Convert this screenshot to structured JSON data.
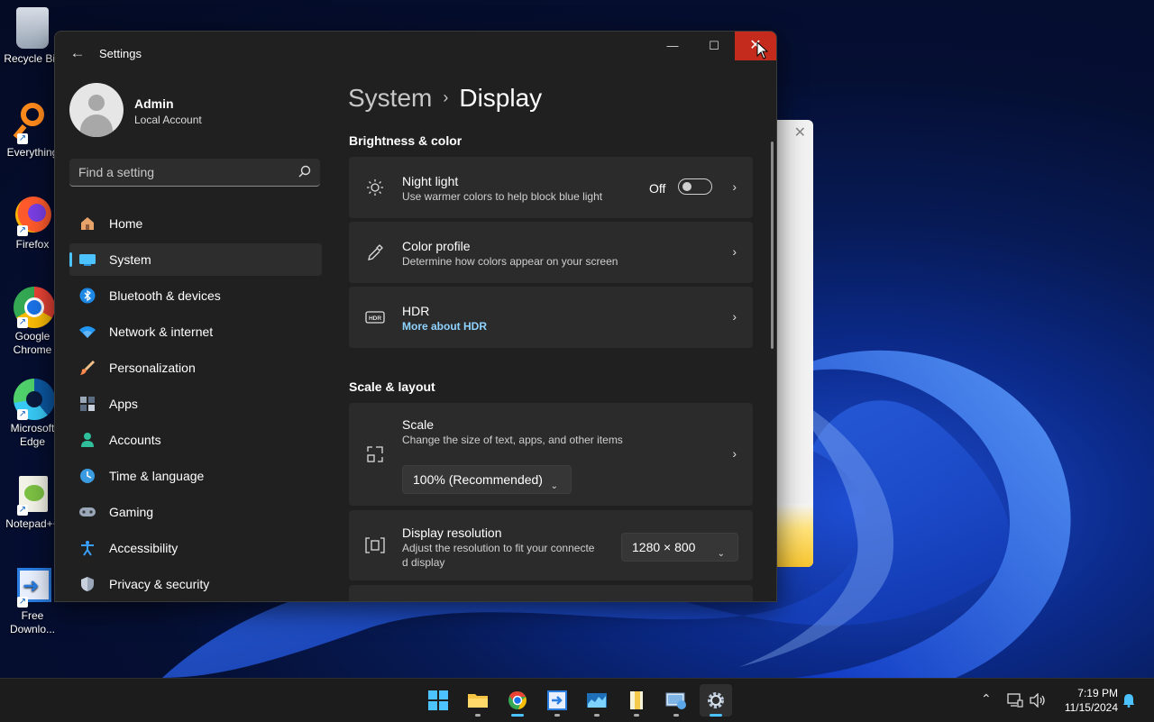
{
  "desktop": {
    "icons": [
      {
        "label": "Recycle Bin",
        "icon": "recycle-bin-icon"
      },
      {
        "label": "Everything",
        "icon": "everything-search-icon"
      },
      {
        "label": "Firefox",
        "icon": "firefox-icon"
      },
      {
        "label": "Google Chrome",
        "icon": "chrome-icon"
      },
      {
        "label": "Microsoft Edge",
        "icon": "edge-icon"
      },
      {
        "label": "Notepad++",
        "icon": "notepad-plus-plus-icon"
      },
      {
        "label": "Free Downlo...",
        "icon": "free-download-manager-icon"
      }
    ]
  },
  "window": {
    "title": "Settings",
    "controls": {
      "minimize": "—",
      "maximize": "☐",
      "close": "✕"
    }
  },
  "profile": {
    "name": "Admin",
    "account_type": "Local Account"
  },
  "search": {
    "placeholder": "Find a setting"
  },
  "nav": {
    "items": [
      {
        "label": "Home",
        "icon": "home-icon"
      },
      {
        "label": "System",
        "icon": "system-display-icon",
        "active": true
      },
      {
        "label": "Bluetooth & devices",
        "icon": "bluetooth-icon"
      },
      {
        "label": "Network & internet",
        "icon": "wifi-icon"
      },
      {
        "label": "Personalization",
        "icon": "paintbrush-icon"
      },
      {
        "label": "Apps",
        "icon": "apps-icon"
      },
      {
        "label": "Accounts",
        "icon": "accounts-icon"
      },
      {
        "label": "Time & language",
        "icon": "time-language-icon"
      },
      {
        "label": "Gaming",
        "icon": "gamepad-icon"
      },
      {
        "label": "Accessibility",
        "icon": "accessibility-icon"
      },
      {
        "label": "Privacy & security",
        "icon": "shield-icon"
      }
    ]
  },
  "breadcrumb": {
    "parent": "System",
    "separator": "›",
    "current": "Display"
  },
  "sections": {
    "brightness": {
      "heading": "Brightness & color",
      "night_light": {
        "title": "Night light",
        "subtitle": "Use warmer colors to help block blue light",
        "state_label": "Off",
        "enabled": false
      },
      "color_profile": {
        "title": "Color profile",
        "subtitle": "Determine how colors appear on your screen"
      },
      "hdr": {
        "title": "HDR",
        "link": "More about HDR"
      }
    },
    "scale_layout": {
      "heading": "Scale & layout",
      "scale": {
        "title": "Scale",
        "subtitle": "Change the size of text, apps, and other items",
        "value": "100% (Recommended)"
      },
      "resolution": {
        "title": "Display resolution",
        "subtitle_line1": "Adjust the resolution to fit your connecte",
        "subtitle_line2": "d display",
        "value": "1280 × 800"
      }
    }
  },
  "taskbar": {
    "apps": [
      "start-icon",
      "file-explorer-icon",
      "chrome-icon",
      "free-download-manager-icon",
      "task-manager-icon",
      "notepad-icon",
      "control-panel-icon",
      "settings-gear-icon"
    ],
    "time": "7:19 PM",
    "date": "11/15/2024"
  },
  "colors": {
    "accent": "#4cc2ff",
    "close_red": "#c42b1c",
    "window_bg": "#202020",
    "card_bg": "#2b2b2b"
  }
}
